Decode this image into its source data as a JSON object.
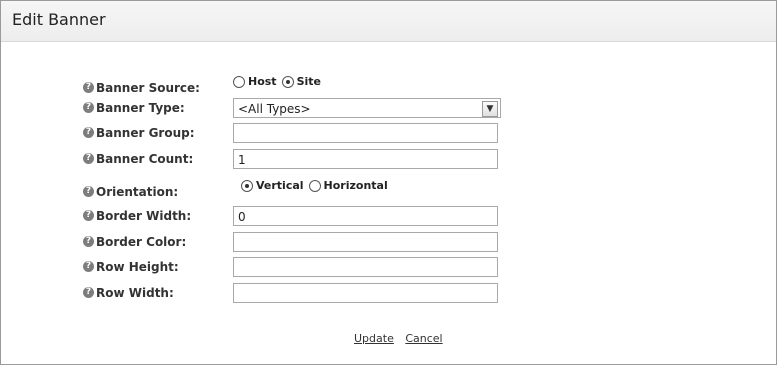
{
  "window": {
    "title": "Edit Banner"
  },
  "form": {
    "banner_source": {
      "label": "Banner Source:",
      "options": [
        {
          "label": "Host",
          "selected": false
        },
        {
          "label": "Site",
          "selected": true
        }
      ]
    },
    "banner_type": {
      "label": "Banner Type:",
      "value": "<All Types>"
    },
    "banner_group": {
      "label": "Banner Group:",
      "value": ""
    },
    "banner_count": {
      "label": "Banner Count:",
      "value": "1"
    },
    "orientation": {
      "label": "Orientation:",
      "options": [
        {
          "label": "Vertical",
          "selected": true
        },
        {
          "label": "Horizontal",
          "selected": false
        }
      ]
    },
    "border_width": {
      "label": "Border Width:",
      "value": "0"
    },
    "border_color": {
      "label": "Border Color:",
      "value": ""
    },
    "row_height": {
      "label": "Row Height:",
      "value": ""
    },
    "row_width": {
      "label": "Row Width:",
      "value": ""
    }
  },
  "actions": {
    "update": "Update",
    "cancel": "Cancel"
  },
  "icons": {
    "help": "help-icon",
    "dropdown": "chevron-down-icon"
  }
}
